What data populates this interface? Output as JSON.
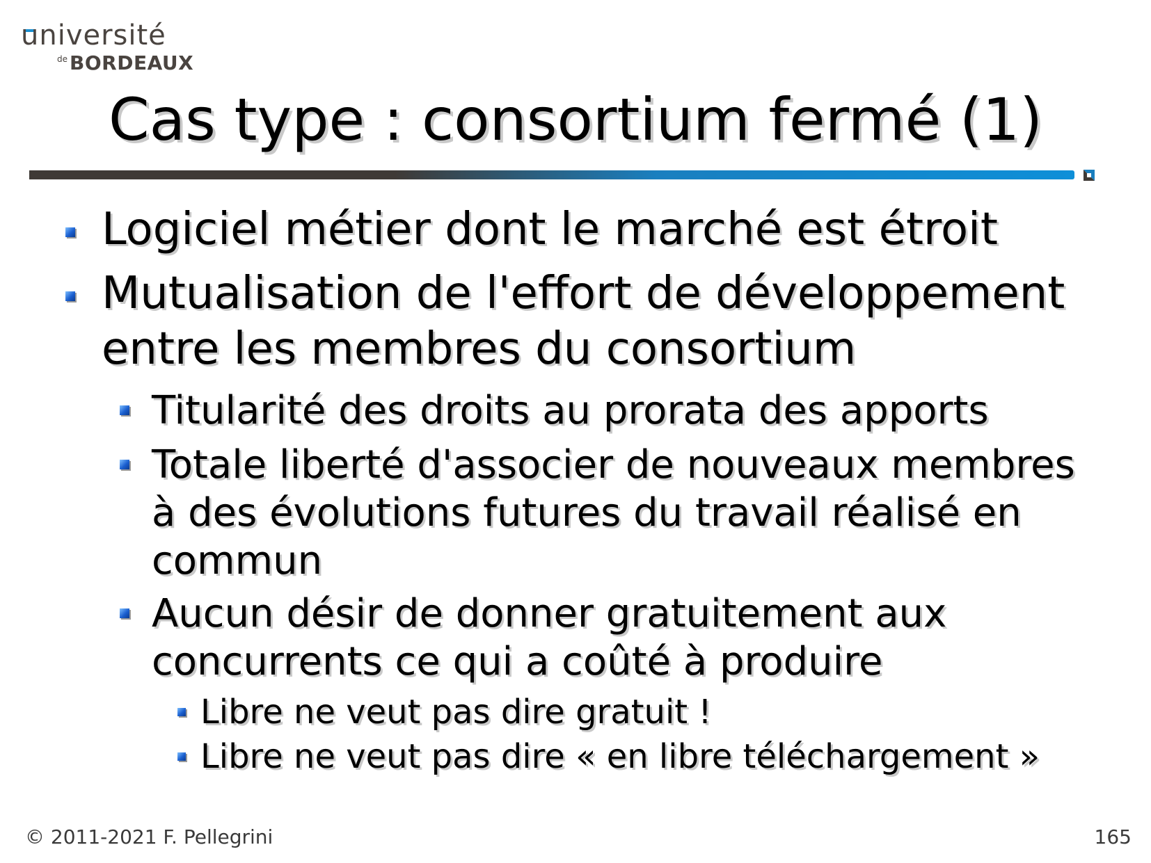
{
  "logo": {
    "line1": "université",
    "de": "de",
    "line2": "BORDEAUX"
  },
  "slide": {
    "title": "Cas type : consortium fermé (1)",
    "bullets": [
      {
        "level": 1,
        "lines": [
          "Logiciel métier dont le marché est étroit"
        ]
      },
      {
        "level": 1,
        "lines": [
          "Mutualisation de l'effort de développement",
          "entre les membres du consortium"
        ]
      },
      {
        "level": 2,
        "lines": [
          "Titularité des droits au prorata des apports"
        ]
      },
      {
        "level": 2,
        "lines": [
          "Totale liberté d'associer de nouveaux membres",
          "à des évolutions futures du travail réalisé en",
          "commun"
        ]
      },
      {
        "level": 2,
        "lines": [
          "Aucun désir de donner gratuitement aux",
          "concurrents ce qui a coûté à produire"
        ]
      },
      {
        "level": 3,
        "lines": [
          "Libre ne veut pas dire gratuit !"
        ]
      },
      {
        "level": 3,
        "lines": [
          "Libre ne veut pas dire « en libre téléchargement »"
        ]
      }
    ]
  },
  "footer": {
    "copyright": "© 2011-2021 F. Pellegrini",
    "page_number": "165"
  },
  "colors": {
    "accent_blue": "#0e8fd8",
    "dark_brown": "#3f3a36",
    "bullet_blue": "#1a5fd0"
  },
  "icons": {
    "bullet": "square-bullet-icon",
    "rule_end": "corner-marker-icon"
  }
}
